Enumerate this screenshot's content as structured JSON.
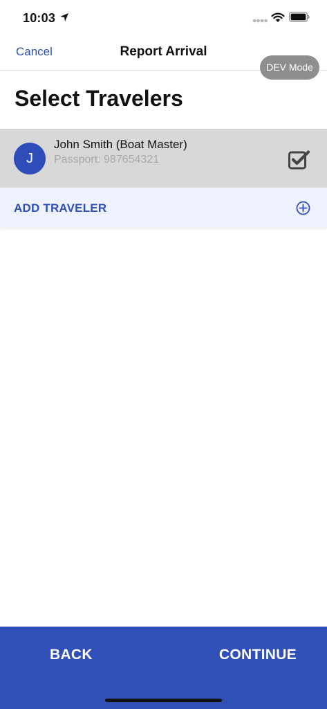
{
  "status_bar": {
    "time": "10:03",
    "icons": [
      "location-arrow-icon",
      "cellular-dots-icon",
      "wifi-icon",
      "battery-icon"
    ]
  },
  "nav": {
    "cancel_label": "Cancel",
    "title": "Report Arrival"
  },
  "dev_badge": "DEV Mode",
  "page_title": "Select Travelers",
  "travelers": [
    {
      "initial": "J",
      "name": "John Smith (Boat Master)",
      "passport": "Passport: 987654321",
      "selected": true
    }
  ],
  "add_traveler_label": "ADD TRAVELER",
  "footer": {
    "back_label": "BACK",
    "continue_label": "CONTINUE"
  },
  "colors": {
    "accent": "#304fb7",
    "link": "#2e4fb8",
    "row_bg": "#d8d8d8",
    "add_row_bg": "#eef2fd"
  }
}
